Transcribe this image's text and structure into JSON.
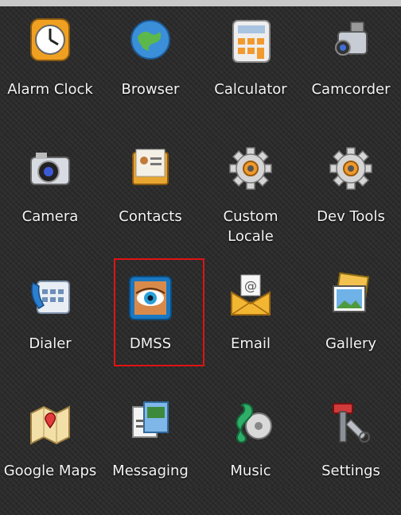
{
  "apps": [
    {
      "label": "Alarm Clock",
      "icon": "alarm-clock-icon"
    },
    {
      "label": "Browser",
      "icon": "globe-icon"
    },
    {
      "label": "Calculator",
      "icon": "calculator-icon"
    },
    {
      "label": "Camcorder",
      "icon": "camcorder-icon"
    },
    {
      "label": "Camera",
      "icon": "camera-icon"
    },
    {
      "label": "Contacts",
      "icon": "contacts-icon"
    },
    {
      "label": "Custom\nLocale",
      "icon": "gear-icon"
    },
    {
      "label": "Dev Tools",
      "icon": "gear-icon"
    },
    {
      "label": "Dialer",
      "icon": "phone-icon"
    },
    {
      "label": "DMSS",
      "icon": "eye-icon"
    },
    {
      "label": "Email",
      "icon": "envelope-icon"
    },
    {
      "label": "Gallery",
      "icon": "photos-icon"
    },
    {
      "label": "Google Maps",
      "icon": "map-icon"
    },
    {
      "label": "Messaging",
      "icon": "messages-icon"
    },
    {
      "label": "Music",
      "icon": "music-icon"
    },
    {
      "label": "Settings",
      "icon": "tools-icon"
    }
  ],
  "highlighted_app": "DMSS",
  "colors": {
    "background": "#2b2b2b",
    "highlight": "#e01313",
    "label": "#f4f4f4"
  }
}
